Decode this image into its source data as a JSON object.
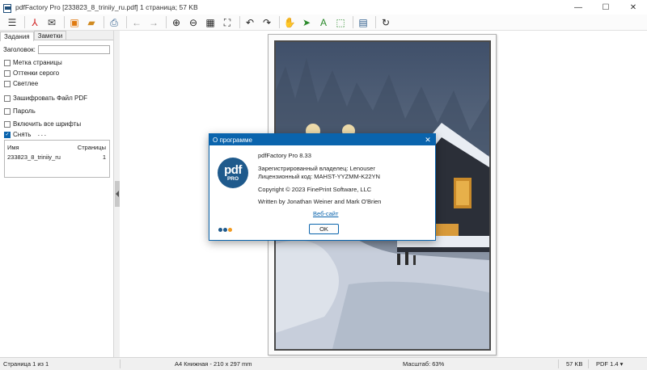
{
  "window": {
    "title": "pdfFactory Pro [233823_8_triniiy_ru.pdf] 1 страница; 57 KB",
    "minimize_glyph": "—",
    "maximize_glyph": "☐",
    "close_glyph": "✕"
  },
  "toolbar": {
    "items": [
      {
        "name": "menu-icon",
        "glyph": "☰",
        "color": "#333333"
      },
      {
        "name": "pdf-acrobat-icon",
        "glyph": "⅄",
        "color": "#d02020"
      },
      {
        "name": "email-icon",
        "glyph": "✉",
        "color": "#333333"
      },
      {
        "name": "save-icon",
        "glyph": "▣",
        "color": "#e07a10"
      },
      {
        "name": "open-folder-icon",
        "glyph": "▰",
        "color": "#d08a20"
      },
      {
        "name": "print-icon",
        "glyph": "⎙",
        "color": "#2a5a8a"
      },
      {
        "name": "back-arrow-icon",
        "glyph": "←",
        "color": "#9a9a9a"
      },
      {
        "name": "forward-arrow-icon",
        "glyph": "→",
        "color": "#9a9a9a"
      },
      {
        "name": "zoom-in-icon",
        "glyph": "⊕",
        "color": "#222222"
      },
      {
        "name": "zoom-out-icon",
        "glyph": "⊖",
        "color": "#222222"
      },
      {
        "name": "thumbnails-grid-icon",
        "glyph": "▦",
        "color": "#222222"
      },
      {
        "name": "fit-page-icon",
        "glyph": "⛶",
        "color": "#222222"
      },
      {
        "name": "undo-icon",
        "glyph": "↶",
        "color": "#222222"
      },
      {
        "name": "redo-icon",
        "glyph": "↷",
        "color": "#222222"
      },
      {
        "name": "hand-tool-icon",
        "glyph": "✋",
        "color": "#9a9a9a"
      },
      {
        "name": "select-arrow-icon",
        "glyph": "➤",
        "color": "#2a8a2a"
      },
      {
        "name": "text-tool-icon",
        "glyph": "A",
        "color": "#2a8a2a"
      },
      {
        "name": "select-region-icon",
        "glyph": "⬚",
        "color": "#2a8a2a"
      },
      {
        "name": "document-info-icon",
        "glyph": "▤",
        "color": "#2a5a8a"
      },
      {
        "name": "refresh-icon",
        "glyph": "↻",
        "color": "#222222"
      }
    ]
  },
  "left_panel": {
    "tabs": [
      {
        "label": "Задания"
      },
      {
        "label": "Заметки"
      }
    ],
    "title_field": {
      "label": "Заголовок:",
      "value": ""
    },
    "options": [
      {
        "label": "Метка страницы",
        "checked": false
      },
      {
        "label": "Оттенки серого",
        "checked": false
      },
      {
        "label": "Светлее",
        "checked": false
      },
      {
        "label": "Зашифровать Файл PDF",
        "checked": false
      },
      {
        "label": "Пароль",
        "checked": false
      },
      {
        "label": "Включить все шрифты",
        "checked": false
      },
      {
        "label": "Снять",
        "checked": true
      }
    ],
    "more_label": "···",
    "file_table": {
      "headers": [
        "Имя",
        "Страницы"
      ],
      "rows": [
        {
          "name": "233823_8_triniiy_ru",
          "pages": "1"
        }
      ]
    }
  },
  "status_bar": {
    "page_info": "Страница 1 из 1",
    "paper": "A4 Книжная - 210 x 297 mm",
    "zoom": "Масштаб: 63%",
    "size": "57 KB",
    "pdf_version": "PDF 1.4 ▾"
  },
  "about_dialog": {
    "title": "О программе",
    "close_glyph": "✕",
    "logo_top": "pdf",
    "logo_bottom": "PRO",
    "product": "pdfFactory Pro 8.33",
    "owner": "Зарегистрированный владелец:  Lenouser",
    "license": "Лицензионный код:  MAHST-YYZMM-K22YN",
    "copyright": "Copyright © 2023 FinePrint Software, LLC",
    "authors": "Written by Jonathan Weiner and Mark O'Brien",
    "website_link": "Веб-сайт",
    "ok_button": "OK",
    "dot_colors": [
      "#1f5a8c",
      "#1f5a8c",
      "#f29a1f"
    ]
  }
}
